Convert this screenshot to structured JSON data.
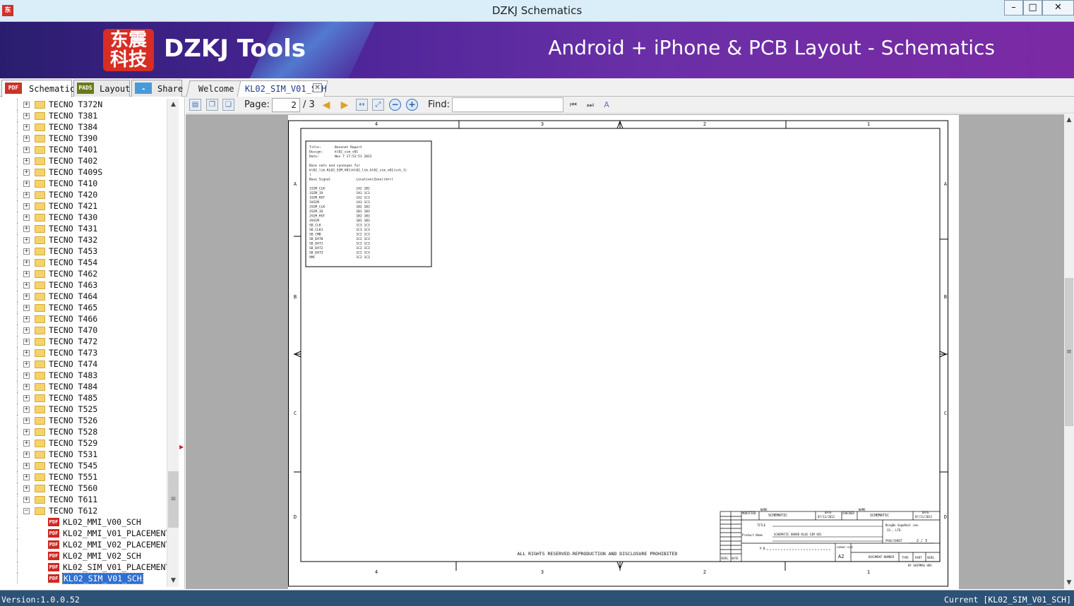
{
  "window": {
    "title": "DZKJ Schematics",
    "minimize_glyph": "–",
    "maximize_glyph": "□",
    "close_glyph": "✕"
  },
  "banner": {
    "logo_chars": "东震科技",
    "brand": "DZKJ Tools",
    "tagline": "Android + iPhone & PCB Layout - Schematics"
  },
  "left_tabs": {
    "schematic": "Schematic",
    "schematic_icon": "PDF",
    "layout": "Layout",
    "layout_icon": "PADS",
    "share": "Share",
    "share_icon": "☁"
  },
  "doc_tabs": {
    "welcome": "Welcome",
    "active": "KL02_SIM_V01_SCH",
    "close_glyph": "✕"
  },
  "tree": {
    "folders": [
      "TECNO T372N",
      "TECNO T381",
      "TECNO T384",
      "TECNO T390",
      "TECNO T401",
      "TECNO T402",
      "TECNO T409S",
      "TECNO T410",
      "TECNO T420",
      "TECNO T421",
      "TECNO T430",
      "TECNO T431",
      "TECNO T432",
      "TECNO T453",
      "TECNO T454",
      "TECNO T462",
      "TECNO T463",
      "TECNO T464",
      "TECNO T465",
      "TECNO T466",
      "TECNO T470",
      "TECNO T472",
      "TECNO T473",
      "TECNO T474",
      "TECNO T483",
      "TECNO T484",
      "TECNO T485",
      "TECNO T525",
      "TECNO T526",
      "TECNO T528",
      "TECNO T529",
      "TECNO T531",
      "TECNO T545",
      "TECNO T551",
      "TECNO T560",
      "TECNO T611"
    ],
    "expanded_folder": "TECNO T612",
    "files": [
      "KL02_MMI_V00_SCH",
      "KL02_MMI_V01_PLACEMENT",
      "KL02_MMI_V02_PLACEMENT",
      "KL02_MMI_V02_SCH",
      "KL02_SIM_V01_PLACEMENT",
      "KL02_SIM_V01_SCH"
    ],
    "selected_file": "KL02_SIM_V01_SCH",
    "file_icon": "PDF"
  },
  "toolbar": {
    "page_label": "Page:",
    "page_value": "2",
    "page_total": "/ 3",
    "find_label": "Find:",
    "find_value": ""
  },
  "schematic": {
    "zones_top": [
      "4",
      "3",
      "2",
      "1"
    ],
    "zones_side": [
      "A",
      "B",
      "C",
      "D"
    ],
    "report_lines": [
      "Title:       Basenet Report",
      "Design:      kl02_sim_v01",
      "Date:        Nov 7 17:52:51 2012",
      "",
      "Base nets and synonyms for",
      "kl02_lib.KL02_SIM_V01(kl02_lib.kl02_sim_v01(sch_1)",
      ")",
      "Base Signal             Location(Zone)(d>r)",
      "",
      "1SIM_CLK                1A2 1B1",
      "1SIM_IO                 1A1 1C3",
      "1SIM_RST                1A2 1C3",
      "1VSIM                   1A1 1C3",
      "2SIM_CLK                1B2 1B3",
      "2SIM_IO                 1B1 1B3",
      "2SIM_RST                1B2 1B3",
      "2VSIM                   1B1 1B3",
      "SD_CLK                  1C3 1C3",
      "SD_CLK1                 1C3 1C3",
      "SD_CMD                  1C2 1C3",
      "SD_DAT0                 1C2 1C3",
      "SD_DAT1                 1C2 1C3",
      "SD_DAT2                 1C2 1C3",
      "SD_DAT3                 1C2 1C3",
      "VMC                     1C2 1C3"
    ],
    "copyright": "ALL RIGHTS RESERVED.REPRODUCTION AND DISCLOSURE PROHIBITED",
    "tb_modified": "MODIFIED",
    "tb_name1": "NAME",
    "tb_val1": "SCHEMATIC",
    "tb_date1": "DATE",
    "tb_dateval1": "07/11/2012",
    "tb_checked": "CHECKED",
    "tb_name2": "NAME",
    "tb_val2": "SCHEMATIC",
    "tb_date2": "DATE",
    "tb_dateval2": "07/11/2012",
    "tb_title": "TITLE",
    "tb_company1": "NingBo SagaReal com.",
    "tb_company2": "CO., LTD.",
    "tb_product": "Product Name",
    "tb_product_val": "SCHEMATIC BOARD KL02 SIM V01",
    "tb_pagesheet": "PAGE/SHEET",
    "tb_pagesheet_val": "2 / 3",
    "tb_pn": "P.N.",
    "tb_format": "FORMAT SIZE",
    "tb_format_val": "A2",
    "tb_docnum": "DOCUMENT NUMBER",
    "tb_type": "TYPE",
    "tb_part": "PART",
    "tb_vers": "VERS.",
    "tb_vers_col": "VERS.",
    "tb_date_col": "DATE",
    "tb_by": "BY SHIPMAG HOS"
  },
  "status": {
    "version": "Version:1.0.0.52",
    "current": "Current [KL02_SIM_V01_SCH]"
  }
}
